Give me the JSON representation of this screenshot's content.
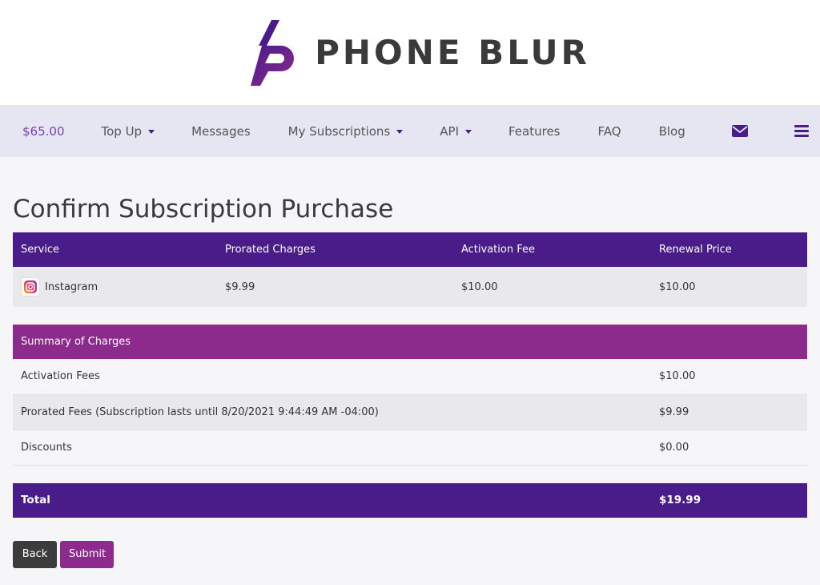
{
  "brand": {
    "name": "PHONE BLUR"
  },
  "nav": {
    "balance": "$65.00",
    "top_up": "Top Up",
    "messages": "Messages",
    "subscriptions": "My Subscriptions",
    "api": "API",
    "features": "Features",
    "faq": "FAQ",
    "blog": "Blog"
  },
  "page": {
    "title": "Confirm Subscription Purchase"
  },
  "purchase_table": {
    "headers": [
      "Service",
      "Prorated Charges",
      "Activation Fee",
      "Renewal Price"
    ],
    "row": {
      "service": "Instagram",
      "prorated": "$9.99",
      "activation": "$10.00",
      "renewal": "$10.00"
    }
  },
  "summary": {
    "header": "Summary of Charges",
    "rows": [
      {
        "label": "Activation Fees",
        "value": "$10.00"
      },
      {
        "label": "Prorated Fees (Subscription lasts until 8/20/2021 9:44:49 AM -04:00)",
        "value": "$9.99"
      },
      {
        "label": "Discounts",
        "value": "$0.00"
      }
    ]
  },
  "total": {
    "label": "Total",
    "value": "$19.99"
  },
  "buttons": {
    "back": "Back",
    "submit": "Submit"
  },
  "colors": {
    "primary": "#4a1c8a",
    "accent": "#8c2b8c",
    "balance": "#7b3fb7"
  }
}
